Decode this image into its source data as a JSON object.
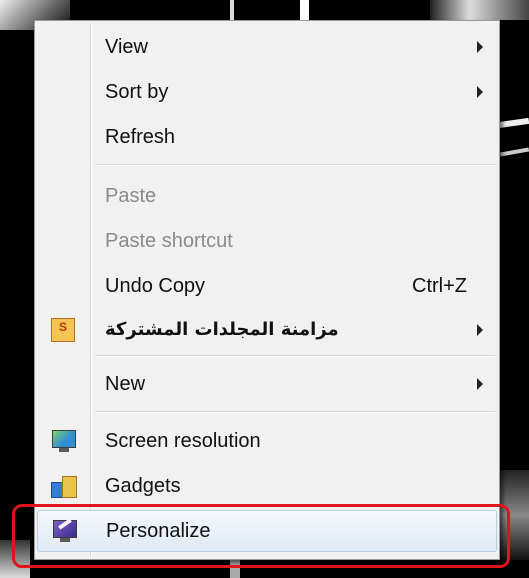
{
  "menu": {
    "items": [
      {
        "id": "view",
        "label": "View",
        "submenu": true,
        "enabled": true
      },
      {
        "id": "sort-by",
        "label": "Sort by",
        "submenu": true,
        "enabled": true
      },
      {
        "id": "refresh",
        "label": "Refresh",
        "submenu": false,
        "enabled": true
      },
      {
        "id": "paste",
        "label": "Paste",
        "submenu": false,
        "enabled": false
      },
      {
        "id": "paste-shortcut",
        "label": "Paste shortcut",
        "submenu": false,
        "enabled": false
      },
      {
        "id": "undo-copy",
        "label": "Undo Copy",
        "shortcut": "Ctrl+Z",
        "submenu": false,
        "enabled": true
      },
      {
        "id": "sync-shared-folders",
        "label": "مزامنة المجلدات المشتركة",
        "submenu": true,
        "enabled": true,
        "icon": "sharepoint-workspace-icon",
        "icon_text": "S"
      },
      {
        "id": "new",
        "label": "New",
        "submenu": true,
        "enabled": true
      },
      {
        "id": "screen-resolution",
        "label": "Screen resolution",
        "submenu": false,
        "enabled": true,
        "icon": "screen-resolution-icon"
      },
      {
        "id": "gadgets",
        "label": "Gadgets",
        "submenu": false,
        "enabled": true,
        "icon": "gadgets-icon"
      },
      {
        "id": "personalize",
        "label": "Personalize",
        "submenu": false,
        "enabled": true,
        "icon": "personalize-icon",
        "highlighted": true
      }
    ]
  },
  "colors": {
    "menu_bg": "#f1f1f1",
    "disabled_text": "#8a8a8a",
    "highlight_outline": "#e0141c",
    "hover_bg": "#dfe9f5"
  }
}
